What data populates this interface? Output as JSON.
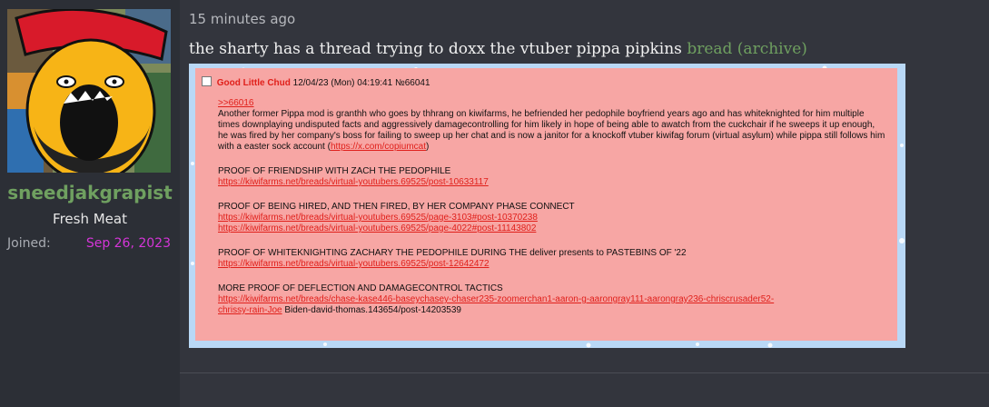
{
  "user": {
    "username": "sneedjakgrapist",
    "title": "Fresh Meat",
    "joined_label": "Joined:",
    "joined_value": "Sep 26, 2023"
  },
  "message": {
    "time": "15 minutes ago",
    "text": "the sharty has a thread trying to doxx the vtuber pippa pipkins",
    "link_label": "bread (archive)"
  },
  "embedded_post": {
    "name": "Good Little Chud",
    "datetime": "12/04/23 (Mon) 04:19:41",
    "number": "№66041",
    "reply_link": ">>66016",
    "paragraph": "Another former Pippa mod is granthh who goes by thhrang on kiwifarms, he befriended her pedophile boyfriend years ago and has whiteknighted for him multiple times downplaying undisputed facts and aggressively damagecontrolling for him likely in hope of being able to awatch from the cuckchair if he sweeps it up enough, he was fired by her company's boss for failing to sweep up her chat and is now a janitor for a knockoff vtuber kiwifag forum (virtual asylum) while pippa still follows him with a easter sock account (",
    "paragraph_link": "https://x.com/copiumcat",
    "paragraph_end": ")",
    "sections": [
      {
        "heading": "PROOF OF FRIENDSHIP WITH ZACH THE PEDOPHILE",
        "links": [
          "https://kiwifarms.net/breads/virtual-youtubers.69525/post-10633117"
        ]
      },
      {
        "heading": "PROOF OF BEING HIRED, AND THEN FIRED, BY HER COMPANY PHASE CONNECT",
        "links": [
          "https://kiwifarms.net/breads/virtual-youtubers.69525/page-3103#post-10370238",
          "https://kiwifarms.net/breads/virtual-youtubers.69525/page-4022#post-11143802"
        ]
      },
      {
        "heading": "PROOF OF WHITEKNIGHTING ZACHARY THE PEDOPHILE DURING THE deliver presents to PASTEBINS OF '22",
        "links": [
          "https://kiwifarms.net/breads/virtual-youtubers.69525/post-12642472"
        ]
      }
    ],
    "last_heading": "MORE PROOF OF DEFLECTION AND DAMAGECONTROL TACTICS",
    "last_link_line1": "https://kiwifarms.net/breads/chase-kase446-baseychasey-chaser235-zoomerchan1-aaron-g-aarongray111-aarongray236-chriscrusader52-",
    "last_link_line2": "chrissy-rain-Joe",
    "last_tail": " Biden-david-thomas.143654/post-14203539"
  },
  "colors": {
    "username": "#6fa060",
    "joined_value": "#d535d8",
    "post_bg": "#f7a6a4",
    "post_name": "#e0201b"
  }
}
